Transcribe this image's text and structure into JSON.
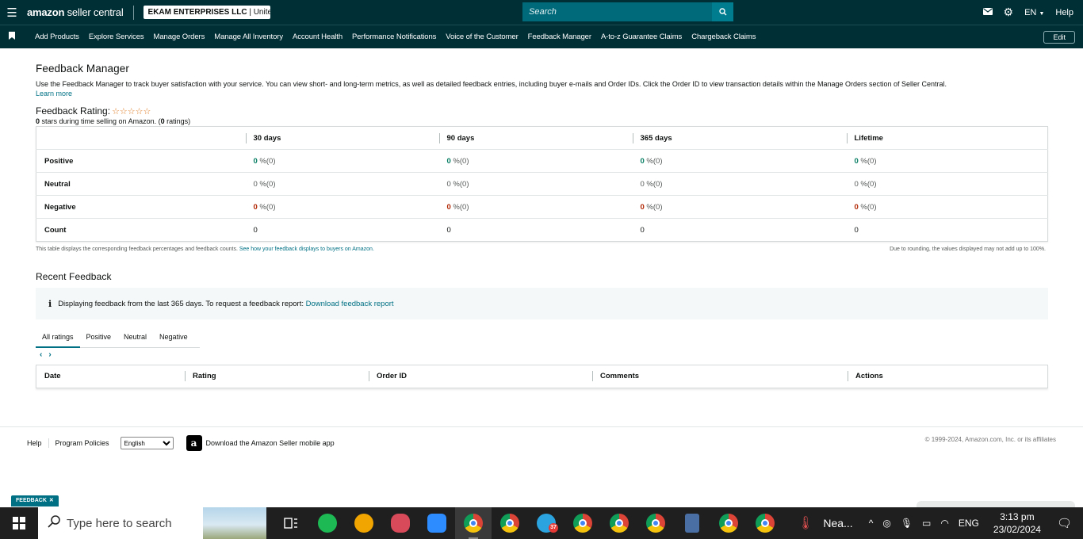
{
  "header": {
    "logo_bold": "amazon",
    "logo_light": "seller central",
    "store_bold": "EKAM ENTERPRISES LLC",
    "store_light": "| Unite...",
    "search_placeholder": "Search",
    "language": "EN",
    "help": "Help"
  },
  "nav": {
    "items": [
      "Add Products",
      "Explore Services",
      "Manage Orders",
      "Manage All Inventory",
      "Account Health",
      "Performance Notifications",
      "Voice of the Customer",
      "Feedback Manager",
      "A-to-z Guarantee Claims",
      "Chargeback Claims"
    ],
    "edit": "Edit"
  },
  "page": {
    "title": "Feedback Manager",
    "description": "Use the Feedback Manager to track buyer satisfaction with your service. You can view short- and long-term metrics, as well as detailed feedback entries, including buyer e-mails and Order IDs. Click the Order ID to view transaction details within the Manage Orders section of Seller Central.",
    "learn_more": "Learn more",
    "rating_title": "Feedback Rating:",
    "stars": "☆☆☆☆☆",
    "rating_count": "0",
    "rating_sub_mid": " stars during time selling on Amazon. (",
    "rating_num": "0",
    "rating_sub_end": " ratings)"
  },
  "feedback_table": {
    "columns": [
      "30 days",
      "90 days",
      "365 days",
      "Lifetime"
    ],
    "rows": [
      {
        "label": "Positive",
        "tone": "green",
        "cells": [
          {
            "v": "0",
            "s": " %(0)"
          },
          {
            "v": "0",
            "s": " %(0)"
          },
          {
            "v": "0",
            "s": " %(0)"
          },
          {
            "v": "0",
            "s": " %(0)"
          }
        ]
      },
      {
        "label": "Neutral",
        "tone": "grey",
        "cells": [
          {
            "v": "0",
            "s": " %(0)"
          },
          {
            "v": "0",
            "s": " %(0)"
          },
          {
            "v": "0",
            "s": " %(0)"
          },
          {
            "v": "0",
            "s": " %(0)"
          }
        ]
      },
      {
        "label": "Negative",
        "tone": "red",
        "cells": [
          {
            "v": "0",
            "s": " %(0)"
          },
          {
            "v": "0",
            "s": " %(0)"
          },
          {
            "v": "0",
            "s": " %(0)"
          },
          {
            "v": "0",
            "s": " %(0)"
          }
        ]
      },
      {
        "label": "Count",
        "tone": "plain",
        "cells": [
          {
            "v": "0",
            "s": ""
          },
          {
            "v": "0",
            "s": ""
          },
          {
            "v": "0",
            "s": ""
          },
          {
            "v": "0",
            "s": ""
          }
        ]
      }
    ],
    "foot_left": "This table displays the corresponding feedback percentages and feedback counts. ",
    "foot_link": "See how your feedback displays to buyers on Amazon.",
    "foot_right": "Due to rounding, the values displayed may not add up to 100%."
  },
  "recent": {
    "title": "Recent Feedback",
    "info_text": "Displaying feedback from the last 365 days. To request a feedback report: ",
    "info_link": "Download feedback report",
    "tabs": [
      "All ratings",
      "Positive",
      "Neutral",
      "Negative"
    ],
    "columns": [
      "Date",
      "Rating",
      "Order ID",
      "Comments",
      "Actions"
    ]
  },
  "footer": {
    "help": "Help",
    "policies": "Program Policies",
    "language_selected": "English",
    "app_text": "Download the Amazon Seller mobile app",
    "copyright": "© 1999-2024, Amazon.com, Inc. or its affiliates"
  },
  "feedback_pill": "FEEDBACK",
  "taskbar": {
    "search_placeholder": "Type here to search",
    "telegram_badge": "37",
    "weather": "Nea...",
    "lang": "ENG",
    "time": "3:13 pm",
    "date": "23/02/2024"
  },
  "colors": {
    "header_bg": "#002f36",
    "search_bg": "#006a7a",
    "link": "#007185",
    "positive": "#067d62",
    "negative": "#b12704"
  }
}
